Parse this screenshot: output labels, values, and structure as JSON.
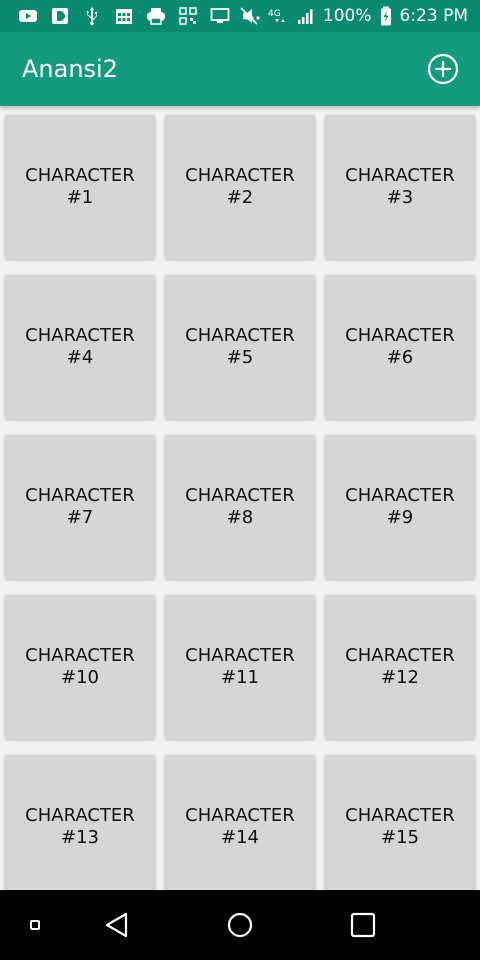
{
  "status_bar": {
    "battery": "100%",
    "time": "6:23 PM",
    "network": "4G",
    "icons": [
      "youtube-icon",
      "d-app-icon",
      "usb-icon",
      "calendar-icon",
      "printer-icon",
      "qr-icon",
      "cast-icon",
      "more-dots-icon",
      "mute-icon",
      "network-4g-icon",
      "signal-icon",
      "battery-charging-icon"
    ],
    "color": "#0b8a72"
  },
  "app_bar": {
    "title": "Anansi2",
    "action_icon": "add-circle-icon",
    "color": "#139a7f"
  },
  "cards": [
    {
      "label": "CHARACTER\n#1"
    },
    {
      "label": "CHARACTER\n#2"
    },
    {
      "label": "CHARACTER\n#3"
    },
    {
      "label": "CHARACTER\n#4"
    },
    {
      "label": "CHARACTER\n#5"
    },
    {
      "label": "CHARACTER\n#6"
    },
    {
      "label": "CHARACTER\n#7"
    },
    {
      "label": "CHARACTER\n#8"
    },
    {
      "label": "CHARACTER\n#9"
    },
    {
      "label": "CHARACTER\n#10"
    },
    {
      "label": "CHARACTER\n#11"
    },
    {
      "label": "CHARACTER\n#12"
    },
    {
      "label": "CHARACTER\n#13"
    },
    {
      "label": "CHARACTER\n#14"
    },
    {
      "label": "CHARACTER\n#15"
    }
  ],
  "nav_bar": {
    "icons": [
      "small-square-icon",
      "back-triangle-icon",
      "home-circle-icon",
      "recents-square-icon"
    ]
  }
}
